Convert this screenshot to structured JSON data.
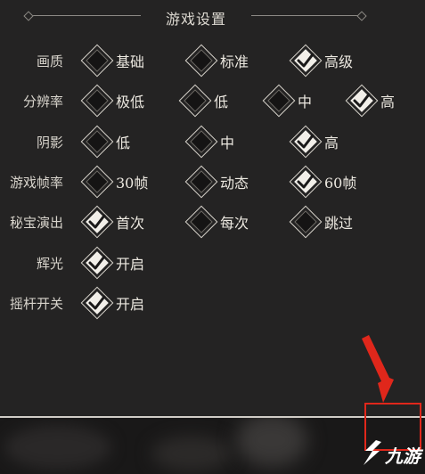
{
  "title": "游戏设置",
  "rows": [
    {
      "label": "画质",
      "options": [
        {
          "label": "基础",
          "checked": false
        },
        {
          "label": "标准",
          "checked": false
        },
        {
          "label": "高级",
          "checked": true
        }
      ]
    },
    {
      "label": "分辨率",
      "options": [
        {
          "label": "极低",
          "checked": false
        },
        {
          "label": "低",
          "checked": false
        },
        {
          "label": "中",
          "checked": false
        },
        {
          "label": "高",
          "checked": true
        }
      ]
    },
    {
      "label": "阴影",
      "options": [
        {
          "label": "低",
          "checked": false
        },
        {
          "label": "中",
          "checked": false
        },
        {
          "label": "高",
          "checked": true
        }
      ]
    },
    {
      "label": "游戏帧率",
      "options": [
        {
          "label": "30帧",
          "checked": false
        },
        {
          "label": "动态",
          "checked": false
        },
        {
          "label": "60帧",
          "checked": true
        }
      ]
    },
    {
      "label": "秘宝演出",
      "options": [
        {
          "label": "首次",
          "checked": true
        },
        {
          "label": "每次",
          "checked": false
        },
        {
          "label": "跳过",
          "checked": false
        }
      ]
    },
    {
      "label": "辉光",
      "options": [
        {
          "label": "开启",
          "checked": true
        }
      ]
    },
    {
      "label": "摇杆开关",
      "options": [
        {
          "label": "开启",
          "checked": true
        }
      ]
    }
  ],
  "watermark": {
    "text": "九游",
    "icon": "jiuyou-logo"
  },
  "colors": {
    "background": "#232222",
    "annotation": "#e0271b"
  }
}
